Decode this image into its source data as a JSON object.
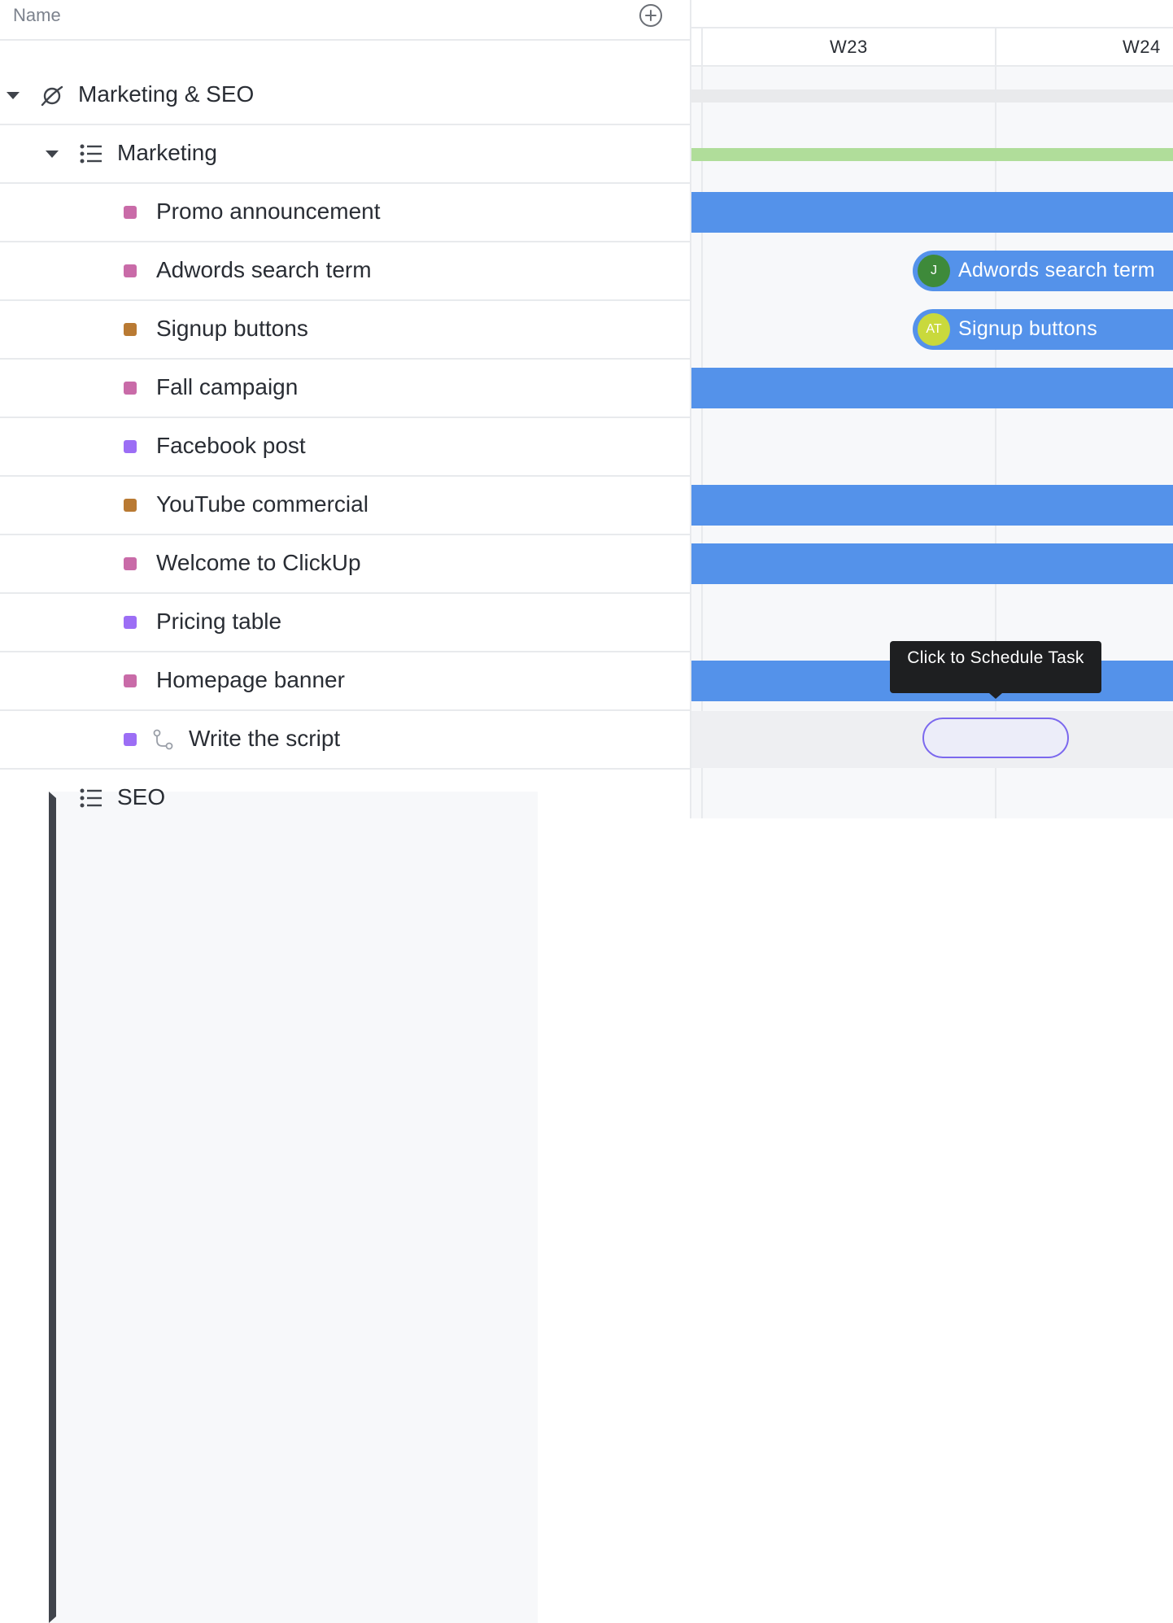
{
  "list_header": {
    "name_column": "Name",
    "add_column_icon": "plus-circle-icon"
  },
  "space": {
    "name": "Marketing & SEO",
    "icon": "planet-icon"
  },
  "lists": [
    {
      "name": "Marketing",
      "icon": "list-icon",
      "expanded": true,
      "tasks": [
        {
          "name": "Promo announcement",
          "status_color": "#c96ba8"
        },
        {
          "name": "Adwords search term",
          "status_color": "#c96ba8"
        },
        {
          "name": "Signup buttons",
          "status_color": "#b97a33"
        },
        {
          "name": "Fall campaign",
          "status_color": "#c96ba8"
        },
        {
          "name": "Facebook post",
          "status_color": "#9c6ef5"
        },
        {
          "name": "YouTube commercial",
          "status_color": "#b97a33"
        },
        {
          "name": "Welcome to ClickUp",
          "status_color": "#c96ba8"
        },
        {
          "name": "Pricing table",
          "status_color": "#9c6ef5"
        },
        {
          "name": "Homepage banner",
          "status_color": "#c96ba8"
        },
        {
          "name": "Write the script",
          "status_color": "#9c6ef5",
          "subtask_icon": "subtask-icon"
        }
      ]
    },
    {
      "name": "SEO",
      "icon": "list-icon",
      "expanded": false
    }
  ],
  "gantt": {
    "weeks": [
      "W23",
      "W24"
    ],
    "bar_color": "#5492ea",
    "list_bar_color": "#b0dd9a",
    "labeled_bars": [
      {
        "task": "Adwords search term",
        "assignee_initials": "J",
        "avatar_color": "#3e8a3a"
      },
      {
        "task": "Signup buttons",
        "assignee_initials": "AT",
        "avatar_color": "#c9d93c"
      }
    ],
    "tooltip": "Click to Schedule Task"
  }
}
